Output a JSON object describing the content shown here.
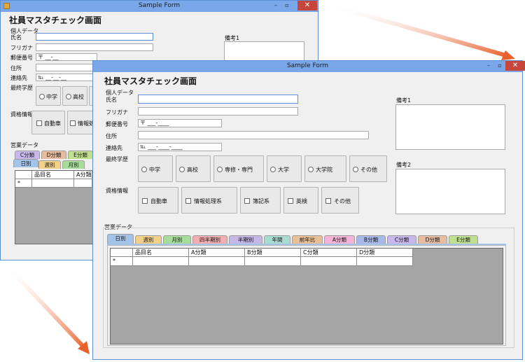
{
  "window": {
    "title": "Sample Form"
  },
  "form": {
    "heading": "社員マスタチェック画面",
    "personal_group": "個人データ",
    "fields": {
      "name_label": "氏名",
      "kana_label": "フリガナ",
      "postal_label": "郵便番号",
      "postal_value": "〒 ___-____",
      "address_label": "住所",
      "contact_label": "連絡先",
      "contact_value": "℡ ___-____-____"
    },
    "education": {
      "label": "最終学歴",
      "options": [
        "中学",
        "高校",
        "専修・専門",
        "大学",
        "大学院",
        "その他"
      ]
    },
    "qualification": {
      "label": "資格情報",
      "options": [
        "自動車",
        "情報処理系",
        "簿記系",
        "英検",
        "その他"
      ]
    },
    "remarks1_label": "備考1",
    "remarks2_label": "備考2",
    "sales_group": "営業データ",
    "tabs": [
      "日別",
      "週別",
      "月別",
      "四半期別",
      "半期別",
      "年間",
      "前年比",
      "A分類",
      "B分類",
      "C分類",
      "D分類",
      "E分類"
    ],
    "tab_colors": [
      "#a3c4e8",
      "#f3d08a",
      "#a8dc9a",
      "#f2aeb0",
      "#c6b7e6",
      "#a8dcd0",
      "#e8c098",
      "#f4b4d8",
      "#a8b8e8",
      "#cab8ec",
      "#e8bca0",
      "#c0e090"
    ],
    "grid": {
      "columns": [
        "品目名",
        "A分類",
        "B分類",
        "C分類",
        "D分類"
      ],
      "row_marker": "*"
    }
  },
  "back_window": {
    "postal_value": "〒 __-__",
    "contact_value": "℡ __-__-__",
    "tabs_row_top": [
      "C分類",
      "D分類",
      "E分類"
    ],
    "tabs_row_bottom": [
      "日別",
      "週別",
      "月別"
    ],
    "education_partial": [
      "中学",
      "高校"
    ],
    "qualification_partial": [
      "自動車",
      "情報処"
    ],
    "grid_columns": [
      "品目名",
      "A分類"
    ]
  },
  "colors": {
    "arrow": "#e8612c",
    "titlebar": "#7aa7ea",
    "close": "#c7463b"
  }
}
